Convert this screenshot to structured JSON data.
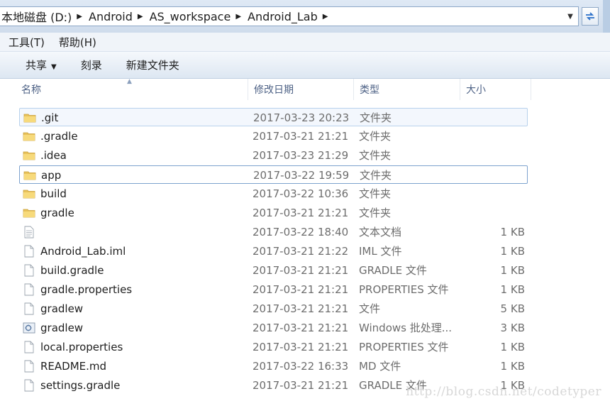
{
  "address_bar": {
    "crumbs": [
      "本地磁盘 (D:)",
      "Android",
      "AS_workspace",
      "Android_Lab"
    ]
  },
  "menu": {
    "items": [
      "工具(T)",
      "帮助(H)"
    ]
  },
  "toolbar": {
    "share_label": "共享",
    "burn_label": "刻录",
    "new_folder_label": "新建文件夹"
  },
  "columns": {
    "name": "名称",
    "date": "修改日期",
    "type": "类型",
    "size": "大小"
  },
  "files": [
    {
      "name": ".git",
      "date": "2017-03-23 20:23",
      "type": "文件夹",
      "size": "",
      "icon": "folder-icon"
    },
    {
      "name": ".gradle",
      "date": "2017-03-21 21:21",
      "type": "文件夹",
      "size": "",
      "icon": "folder-icon"
    },
    {
      "name": ".idea",
      "date": "2017-03-23 21:29",
      "type": "文件夹",
      "size": "",
      "icon": "folder-icon"
    },
    {
      "name": "app",
      "date": "2017-03-22 19:59",
      "type": "文件夹",
      "size": "",
      "icon": "folder-icon"
    },
    {
      "name": "build",
      "date": "2017-03-22 10:36",
      "type": "文件夹",
      "size": "",
      "icon": "folder-icon"
    },
    {
      "name": "gradle",
      "date": "2017-03-21 21:21",
      "type": "文件夹",
      "size": "",
      "icon": "folder-icon"
    },
    {
      "name": "",
      "date": "2017-03-22 18:40",
      "type": "文本文档",
      "size": "1 KB",
      "icon": "text-document-icon"
    },
    {
      "name": "Android_Lab.iml",
      "date": "2017-03-21 21:22",
      "type": "IML 文件",
      "size": "1 KB",
      "icon": "file-icon"
    },
    {
      "name": "build.gradle",
      "date": "2017-03-21 21:21",
      "type": "GRADLE 文件",
      "size": "1 KB",
      "icon": "file-icon"
    },
    {
      "name": "gradle.properties",
      "date": "2017-03-21 21:21",
      "type": "PROPERTIES 文件",
      "size": "1 KB",
      "icon": "file-icon"
    },
    {
      "name": "gradlew",
      "date": "2017-03-21 21:21",
      "type": "文件",
      "size": "5 KB",
      "icon": "file-icon"
    },
    {
      "name": "gradlew",
      "date": "2017-03-21 21:21",
      "type": "Windows 批处理...",
      "size": "3 KB",
      "icon": "batch-file-icon"
    },
    {
      "name": "local.properties",
      "date": "2017-03-21 21:21",
      "type": "PROPERTIES 文件",
      "size": "1 KB",
      "icon": "file-icon"
    },
    {
      "name": "README.md",
      "date": "2017-03-22 16:33",
      "type": "MD 文件",
      "size": "1 KB",
      "icon": "file-icon"
    },
    {
      "name": "settings.gradle",
      "date": "2017-03-21 21:21",
      "type": "GRADLE 文件",
      "size": "1 KB",
      "icon": "file-icon"
    }
  ],
  "watermark": "http://blog.csdn.net/codetyper",
  "colors": {
    "accent": "#4d6185",
    "hover_border": "#b8d1ec",
    "folder": "#e8c25b"
  }
}
